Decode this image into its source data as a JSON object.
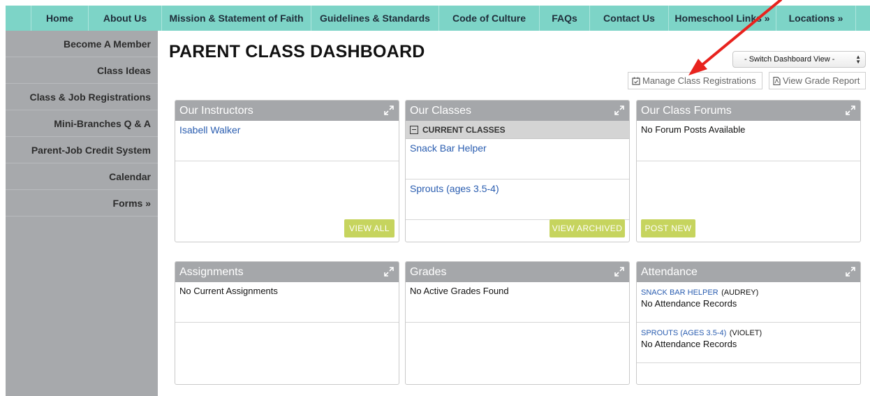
{
  "nav": {
    "items": [
      "Home",
      "About Us",
      "Mission & Statement of Faith",
      "Guidelines & Standards",
      "Code of Culture",
      "FAQs",
      "Contact Us",
      "Homeschool Links »",
      "Locations »"
    ]
  },
  "sidebar": {
    "items": [
      "Become A Member",
      "Class Ideas",
      "Class & Job Registrations",
      "Mini-Branches Q & A",
      "Parent-Job Credit System",
      "Calendar",
      "Forms »"
    ]
  },
  "page": {
    "title": "PARENT CLASS DASHBOARD",
    "switch_view": "- Switch Dashboard View -",
    "manage_btn": "Manage Class Registrations",
    "grade_btn": "View Grade Report"
  },
  "panels": {
    "instructors": {
      "title": "Our Instructors",
      "items": [
        "Isabell Walker"
      ],
      "button": "VIEW ALL"
    },
    "classes": {
      "title": "Our Classes",
      "subhead": "CURRENT CLASSES",
      "items": [
        "Snack Bar Helper",
        "Sprouts (ages 3.5-4)"
      ],
      "button": "VIEW ARCHIVED"
    },
    "forums": {
      "title": "Our Class Forums",
      "empty": "No Forum Posts Available",
      "button": "POST NEW"
    },
    "assignments": {
      "title": "Assignments",
      "empty": "No Current Assignments"
    },
    "grades": {
      "title": "Grades",
      "empty": "No Active Grades Found"
    },
    "attendance": {
      "title": "Attendance",
      "records": [
        {
          "class": "SNACK BAR HELPER",
          "student": "(AUDREY)",
          "status": "No Attendance Records"
        },
        {
          "class": "SPROUTS (AGES 3.5-4)",
          "student": "(VIOLET)",
          "status": "No Attendance Records"
        }
      ]
    }
  },
  "colors": {
    "nav_bg": "#7dd4c7",
    "sidebar_bg": "#a7a9ac",
    "panel_head": "#a5a7aa",
    "button_green": "#c6d45e",
    "link": "#2a5db0",
    "annotation_arrow": "#e8231e"
  }
}
